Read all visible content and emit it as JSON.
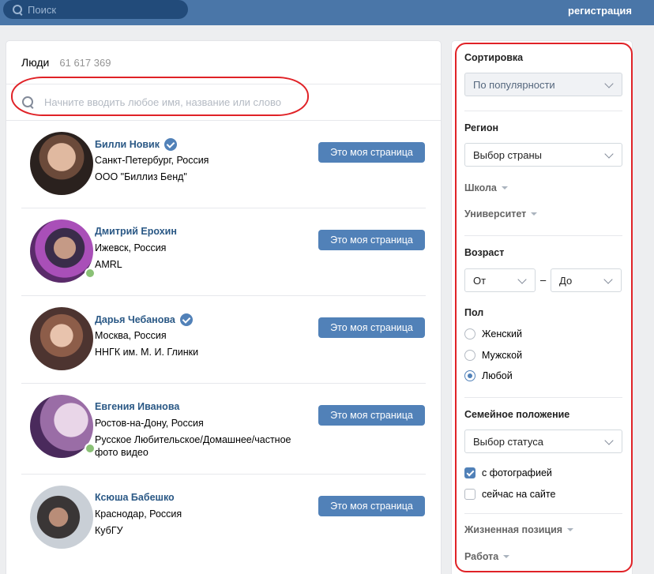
{
  "topbar": {
    "search_placeholder": "Поиск",
    "register_link": "регистрация"
  },
  "main": {
    "title": "Люди",
    "count": "61 617 369",
    "search_placeholder": "Начните вводить любое имя, название или слово"
  },
  "people": [
    {
      "name": "Билли Новик",
      "verified": true,
      "online": false,
      "line1": "Санкт-Петербург, Россия",
      "line2": "ООО \"Биллиз Бенд\"",
      "button": "Это моя страница"
    },
    {
      "name": "Дмитрий Ерохин",
      "verified": false,
      "online": true,
      "line1": "Ижевск, Россия",
      "line2": "AMRL",
      "button": "Это моя страница"
    },
    {
      "name": "Дарья Чебанова",
      "verified": true,
      "online": false,
      "line1": "Москва, Россия",
      "line2": "ННГК им. М. И. Глинки",
      "button": "Это моя страница"
    },
    {
      "name": "Евгения Иванова",
      "verified": false,
      "online": true,
      "line1": "Ростов-на-Дону, Россия",
      "line2": "Русское Любительское/Домашнее/частное",
      "line3": "фото видео",
      "button": "Это моя страница"
    },
    {
      "name": "Ксюша Бабешко",
      "verified": false,
      "online": false,
      "line1": "Краснодар, Россия",
      "line2": "КубГУ",
      "button": "Это моя страница"
    }
  ],
  "filters": {
    "sort_label": "Сортировка",
    "sort_value": "По популярности",
    "region_label": "Регион",
    "region_value": "Выбор страны",
    "school": "Школа",
    "university": "Университет",
    "age_label": "Возраст",
    "age_from": "От",
    "age_dash": "–",
    "age_to": "До",
    "sex_label": "Пол",
    "sex_options": [
      "Женский",
      "Мужской",
      "Любой"
    ],
    "sex_selected": "Любой",
    "marital_label": "Семейное положение",
    "marital_value": "Выбор статуса",
    "with_photo": "с фотографией",
    "with_photo_checked": true,
    "online_now": "сейчас на сайте",
    "online_now_checked": false,
    "life_position": "Жизненная позиция",
    "work": "Работа"
  },
  "colors": {
    "header_bg": "#4a76a8",
    "accent": "#5181b8",
    "link": "#2a5885",
    "online": "#8ac176",
    "annotation": "#e02227"
  }
}
